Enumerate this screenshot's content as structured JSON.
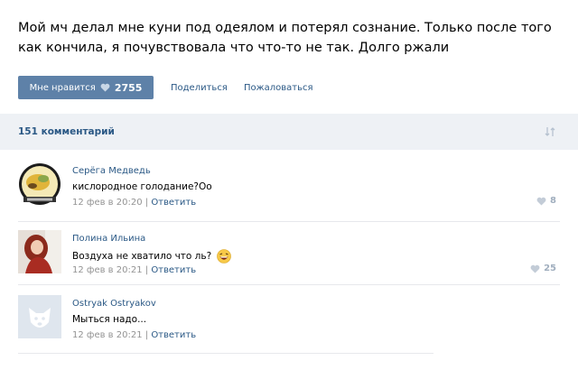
{
  "post": {
    "text": "Мой мч делал мне куни под одеялом и потерял сознание. Только после того как кончила, я почувствовала что что-то не так. Долго ржали",
    "like_label": "Мне нравится",
    "like_count": "2755",
    "share_label": "Поделиться",
    "report_label": "Пожаловаться"
  },
  "comments_header": {
    "count_label": "151 комментарий"
  },
  "comments": [
    {
      "author": "Серёга Медведь",
      "text": "кислородное голодание?Оо",
      "date": "12 фев в 20:20",
      "separator": " | ",
      "reply": "Ответить",
      "likes": "8"
    },
    {
      "author": "Полина Ильина",
      "text": "Воздуха не хватило что ль?",
      "date": "12 фев в 20:21",
      "separator": " | ",
      "reply": "Ответить",
      "likes": "25"
    },
    {
      "author": "Ostryak Ostryakov",
      "text": "Мыться надо...",
      "date": "12 фев в 20:21",
      "separator": " | ",
      "reply": "Ответить",
      "likes": ""
    }
  ],
  "colors": {
    "accent": "#5e81a8",
    "link": "#2a5885",
    "header_bg": "#eef1f5",
    "muted": "#939393"
  },
  "icons": [
    "heart-icon",
    "sort-icon",
    "laughing-emoji-icon",
    "vk-dog-avatar-icon"
  ]
}
